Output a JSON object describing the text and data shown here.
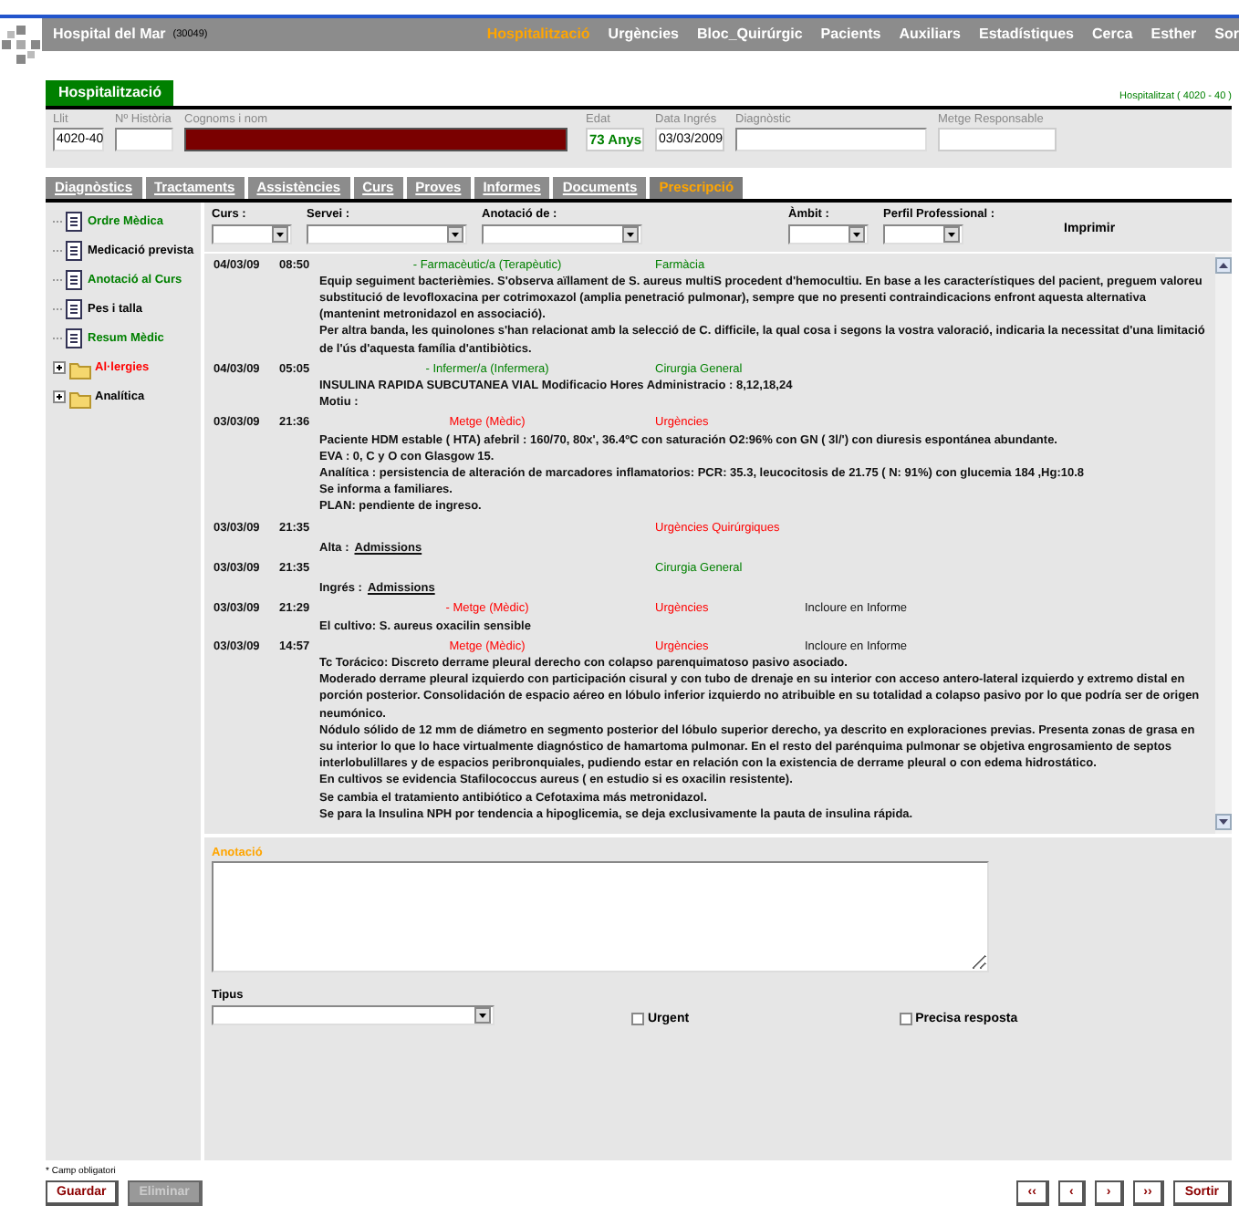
{
  "header": {
    "app_title": "Hospital del Mar",
    "code": "(30049)",
    "nav": [
      {
        "label": "Hospitalització",
        "selected": true
      },
      {
        "label": "Urgències",
        "selected": false
      },
      {
        "label": "Bloc_Quirúrgic",
        "selected": false
      },
      {
        "label": "Pacients",
        "selected": false
      },
      {
        "label": "Auxiliars",
        "selected": false
      },
      {
        "label": "Estadístiques",
        "selected": false
      },
      {
        "label": "Cerca",
        "selected": false
      },
      {
        "label": "Esther",
        "selected": false
      },
      {
        "label": "Sor",
        "selected": false
      }
    ]
  },
  "section": {
    "title": "Hospitalització",
    "status": "Hospitalitzat ( 4020 - 40 )"
  },
  "patient": {
    "fields": [
      {
        "label": "Llit",
        "kind": "input",
        "value": "4020-40"
      },
      {
        "label": "Nº Història",
        "kind": "input"
      },
      {
        "label": "Cognoms i nom",
        "kind": "redacted"
      },
      {
        "label": "Edat",
        "kind": "badge",
        "value": "73 Anys"
      },
      {
        "label": "Data Ingrés",
        "kind": "readonly",
        "value": "03/03/2009"
      },
      {
        "label": "Diagnòstic",
        "kind": "input"
      },
      {
        "label": "Metge Responsable",
        "kind": "readonly"
      }
    ]
  },
  "tabs": [
    {
      "label": "Diagnòstics",
      "selected": false
    },
    {
      "label": "Tractaments",
      "selected": false
    },
    {
      "label": "Assistències",
      "selected": false
    },
    {
      "label": "Curs",
      "selected": false
    },
    {
      "label": "Proves",
      "selected": false
    },
    {
      "label": "Informes",
      "selected": false
    },
    {
      "label": "Documents",
      "selected": false
    },
    {
      "label": "Prescripció",
      "selected": true
    }
  ],
  "sidebar": {
    "items": [
      {
        "label": "Ordre Mèdica",
        "kind": "document",
        "color": "#008000"
      },
      {
        "label": "Medicació prevista",
        "kind": "document",
        "color": "#000000"
      },
      {
        "label": "Anotació al Curs",
        "kind": "document",
        "color": "#008000"
      },
      {
        "label": "Pes i talla",
        "kind": "document",
        "color": "#000000"
      },
      {
        "label": "Resum Mèdic",
        "kind": "document",
        "color": "#008000"
      },
      {
        "label": "Al·lergies",
        "kind": "folder",
        "color": "#ff0000",
        "expanded": false
      },
      {
        "label": "Analítica",
        "kind": "folder",
        "color": "#000000",
        "expanded": false
      }
    ]
  },
  "filters": {
    "fields": [
      {
        "label": "Curs :"
      },
      {
        "label": "Servei :"
      },
      {
        "label": "Anotació de :"
      },
      {
        "label": "Àmbit :"
      },
      {
        "label": "Perfil Professional :"
      }
    ],
    "print_button": "Imprimir"
  },
  "notes": [
    {
      "date": "04/03/09",
      "time": "08:50",
      "author": {
        "text": "- Farmacèutic/a (Terapèutic)",
        "color": "#008000"
      },
      "service": {
        "text": "Farmàcia",
        "color": "#008000"
      },
      "lines": [
        "Equip seguiment bacterièmies. S'observa aïllament de S. aureus multiS procedent d'hemocultiu. En base a les característiques del pacient, preguem valoreu substitució de levofloxacina per cotrimoxazol (amplia penetració pulmonar), sempre que no presenti contraindicacions enfront aquesta alternativa (mantenint metronidazol en associació).",
        "Per altra banda, les quinolones s'han relacionat amb la selecció de C. difficile, la qual cosa i segons la vostra valoració, indicaria la necessitat d'una limitació de l'ús d'aquesta família d'antibiòtics."
      ]
    },
    {
      "date": "04/03/09",
      "time": "05:05",
      "author": {
        "text": "- Infermer/a (Infermera)",
        "color": "#008000"
      },
      "service": {
        "text": "Cirurgia General",
        "color": "#008000"
      },
      "lines": [
        "INSULINA RAPIDA SUBCUTANEA VIAL Modificacio Hores Administracio : 8,12,18,24",
        "Motiu :"
      ]
    },
    {
      "date": "03/03/09",
      "time": "21:36",
      "author": {
        "text": "Metge (Mèdic)",
        "color": "#ff0000"
      },
      "service": {
        "text": "Urgències",
        "color": "#ff0000"
      },
      "lines": [
        "Paciente HDM estable ( HTA) afebril : 160/70, 80x', 36.4ºC con saturación O2:96% con GN ( 3l/') con diuresis espontánea abundante.",
        "EVA : 0, C y O con Glasgow 15.",
        "Analítica : persistencia de alteración de marcadores inflamatorios: PCR: 35.3, leucocitosis de 21.75 ( N: 91%) con glucemia 184 ,Hg:10.8",
        "Se informa a familiares.",
        "PLAN: pendiente de ingreso."
      ]
    },
    {
      "date": "03/03/09",
      "time": "21:35",
      "service": {
        "text": "Urgències Quirúrgiques",
        "color": "#ff0000"
      },
      "link": {
        "label": "Alta :",
        "text": "Admissions"
      }
    },
    {
      "date": "03/03/09",
      "time": "21:35",
      "service": {
        "text": "Cirurgia General",
        "color": "#008000"
      },
      "link": {
        "label": "Ingrés :",
        "text": "Admissions"
      }
    },
    {
      "date": "03/03/09",
      "time": "21:29",
      "author": {
        "text": "- Metge (Mèdic)",
        "color": "#ff0000"
      },
      "service": {
        "text": "Urgències",
        "color": "#ff0000"
      },
      "extra": "Incloure en Informe",
      "lines": [
        "El cultivo: S. aureus oxacilin sensible"
      ]
    },
    {
      "date": "03/03/09",
      "time": "14:57",
      "author": {
        "text": "Metge (Mèdic)",
        "color": "#ff0000"
      },
      "service": {
        "text": "Urgències",
        "color": "#ff0000"
      },
      "extra": "Incloure en Informe",
      "lines": [
        "Tc Torácico: Discreto derrame pleural derecho con colapso parenquimatoso pasivo asociado.",
        "Moderado derrame pleural izquierdo con participación cisural y con tubo de drenaje en su interior con acceso antero-lateral izquierdo y extremo distal en porción posterior. Consolidación de espacio aéreo en lóbulo inferior izquierdo no atribuible en su totalidad a colapso pasivo por lo que podría ser de origen neumónico.",
        "Nódulo sólido de 12 mm de diámetro en segmento posterior del lóbulo superior derecho, ya descrito en exploraciones previas. Presenta zonas de grasa en su interior lo que lo hace virtualmente diagnóstico de hamartoma pulmonar. En el resto del parénquima pulmonar se objetiva engrosamiento de septos interlobulillares y de espacios peribronquiales, pudiendo estar en relación con la existencia de derrame pleural o con edema hidrostático.",
        "En cultivos se evidencia Stafilococcus aureus ( en estudio si es oxacilin resistente).",
        "Se cambia el tratamiento antibiótico a Cefotaxima más metronidazol.",
        "Se para la Insulina NPH por tendencia a hipoglicemia, se deja exclusivamente la pauta de insulina rápida."
      ]
    }
  ],
  "compose": {
    "annotation_label": "Anotació",
    "type_label": "Tipus",
    "checkboxes": [
      {
        "label": "Urgent",
        "checked": false
      },
      {
        "label": "Precisa resposta",
        "checked": false
      }
    ]
  },
  "footer": {
    "note": "* Camp obligatori",
    "buttons": [
      {
        "label": "Guardar",
        "disabled": false
      },
      {
        "label": "Eliminar",
        "disabled": true
      }
    ],
    "pager": [
      "‹‹",
      "‹",
      "›",
      "››"
    ],
    "exit": "Sortir"
  }
}
